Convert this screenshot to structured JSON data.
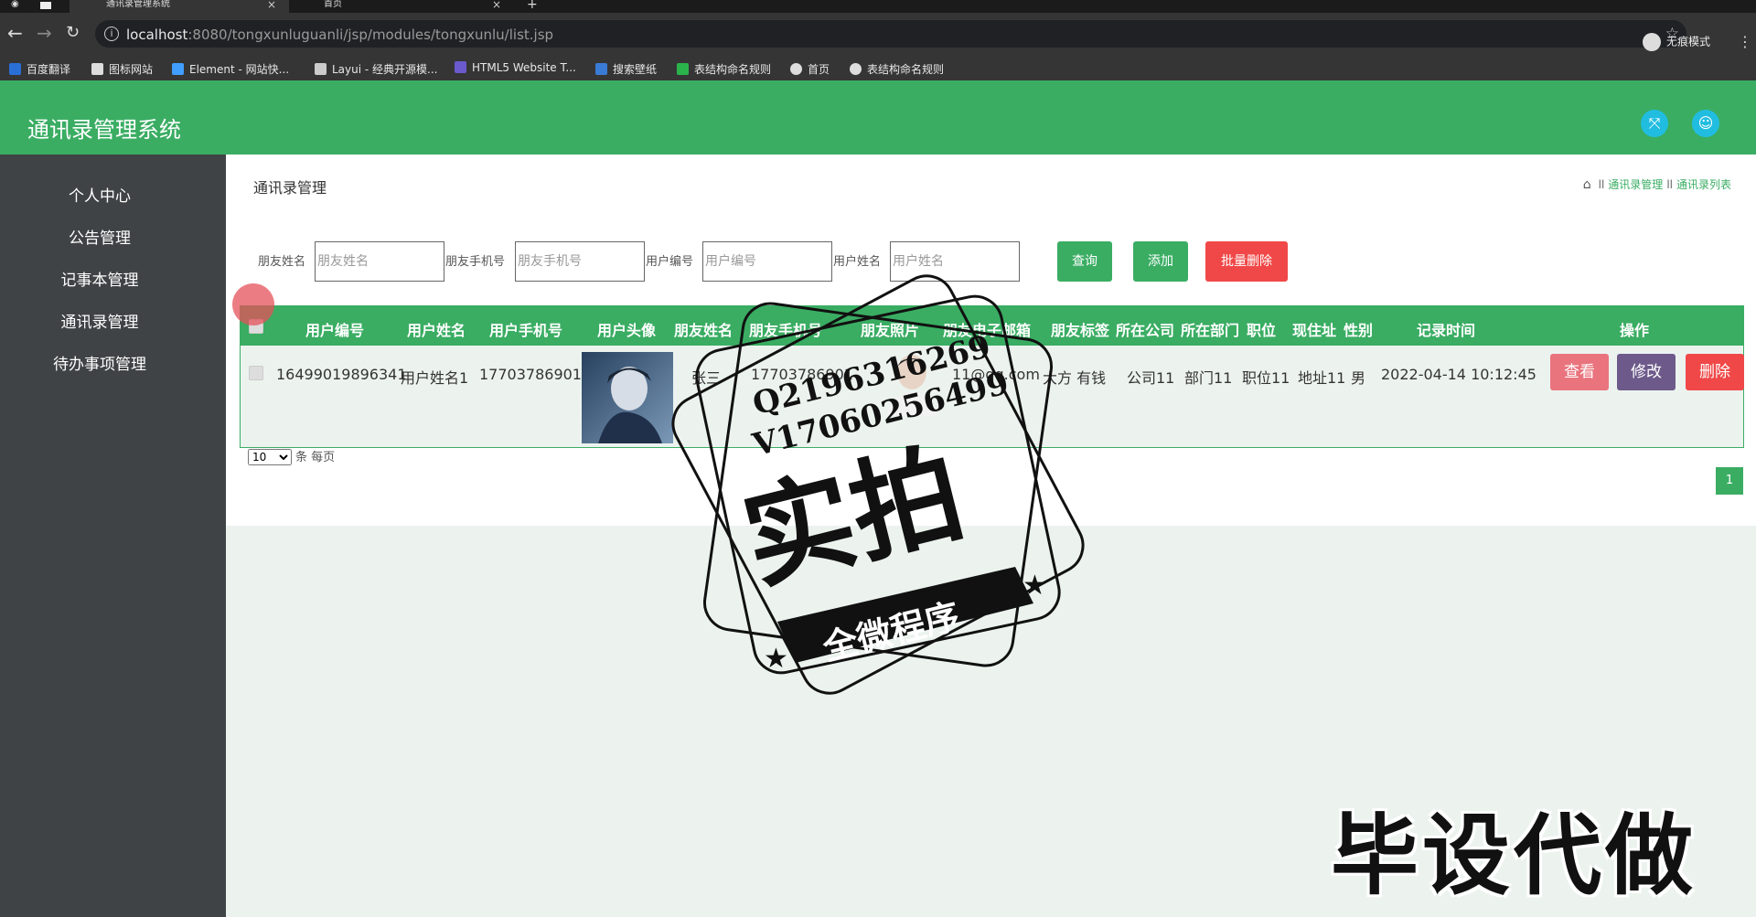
{
  "browser": {
    "tabs": [
      {
        "title": "通讯录管理系统"
      },
      {
        "title": "首页"
      }
    ],
    "url_host": "localhost",
    "url_path": ":8080/tongxunluguanli/jsp/modules/tongxunlu/list.jsp",
    "incognito_label": "无痕模式",
    "bookmarks": [
      "百度翻译",
      "图标网站",
      "Element - 网站快...",
      "Layui - 经典开源模...",
      "HTML5 Website T...",
      "搜索壁纸",
      "表结构命名规则",
      "首页",
      "表结构命名规则"
    ]
  },
  "app": {
    "title": "通讯录管理系统"
  },
  "sidebar": {
    "items": [
      {
        "label": "个人中心"
      },
      {
        "label": "公告管理"
      },
      {
        "label": "记事本管理"
      },
      {
        "label": "通讯录管理"
      },
      {
        "label": "待办事项管理"
      }
    ]
  },
  "page": {
    "heading": "通讯录管理",
    "breadcrumb": [
      "通讯录管理",
      "通讯录列表"
    ]
  },
  "filters": {
    "friend_name_label": "朋友姓名",
    "friend_name_placeholder": "朋友姓名",
    "friend_phone_label": "朋友手机号",
    "friend_phone_placeholder": "朋友手机号",
    "user_no_label": "用户编号",
    "user_no_placeholder": "用户编号",
    "user_name_label": "用户姓名",
    "user_name_placeholder": "用户姓名",
    "query_label": "查询",
    "add_label": "添加",
    "batch_delete_label": "批量删除"
  },
  "table": {
    "columns": [
      "用户编号",
      "用户姓名",
      "用户手机号",
      "用户头像",
      "朋友姓名",
      "朋友手机号",
      "朋友照片",
      "朋友电子邮箱",
      "朋友标签",
      "所在公司",
      "所在部门",
      "职位",
      "现住址",
      "性别",
      "记录时间",
      "操作"
    ],
    "rows": [
      {
        "user_no": "16499019896341",
        "user_name": "用户姓名1",
        "user_phone": "17703786901",
        "friend_name": "张三",
        "friend_phone": "17703786901",
        "friend_email": "11@qq.com",
        "friend_tag": "大方 有钱",
        "company": "公司11",
        "department": "部门11",
        "position": "职位11",
        "address": "地址11",
        "gender": "男",
        "record_time": "2022-04-14 10:12:45"
      }
    ],
    "actions": {
      "view": "查看",
      "edit": "修改",
      "delete": "删除"
    }
  },
  "pagination": {
    "page_size": "10",
    "page_size_suffix": "条 每页",
    "current_page": "1"
  },
  "watermarks": {
    "stamp_line1": "Q2196316269",
    "stamp_line2": "V17060256499",
    "stamp_main": "实拍",
    "stamp_ribbon": "全微程序",
    "bottom": "毕设代做"
  },
  "colors": {
    "primary": "#3aad63",
    "danger": "#f04848",
    "view": "#e9747e",
    "edit": "#6d5a8a",
    "sidebar": "#3f4345",
    "header_icon": "#21bde0"
  }
}
